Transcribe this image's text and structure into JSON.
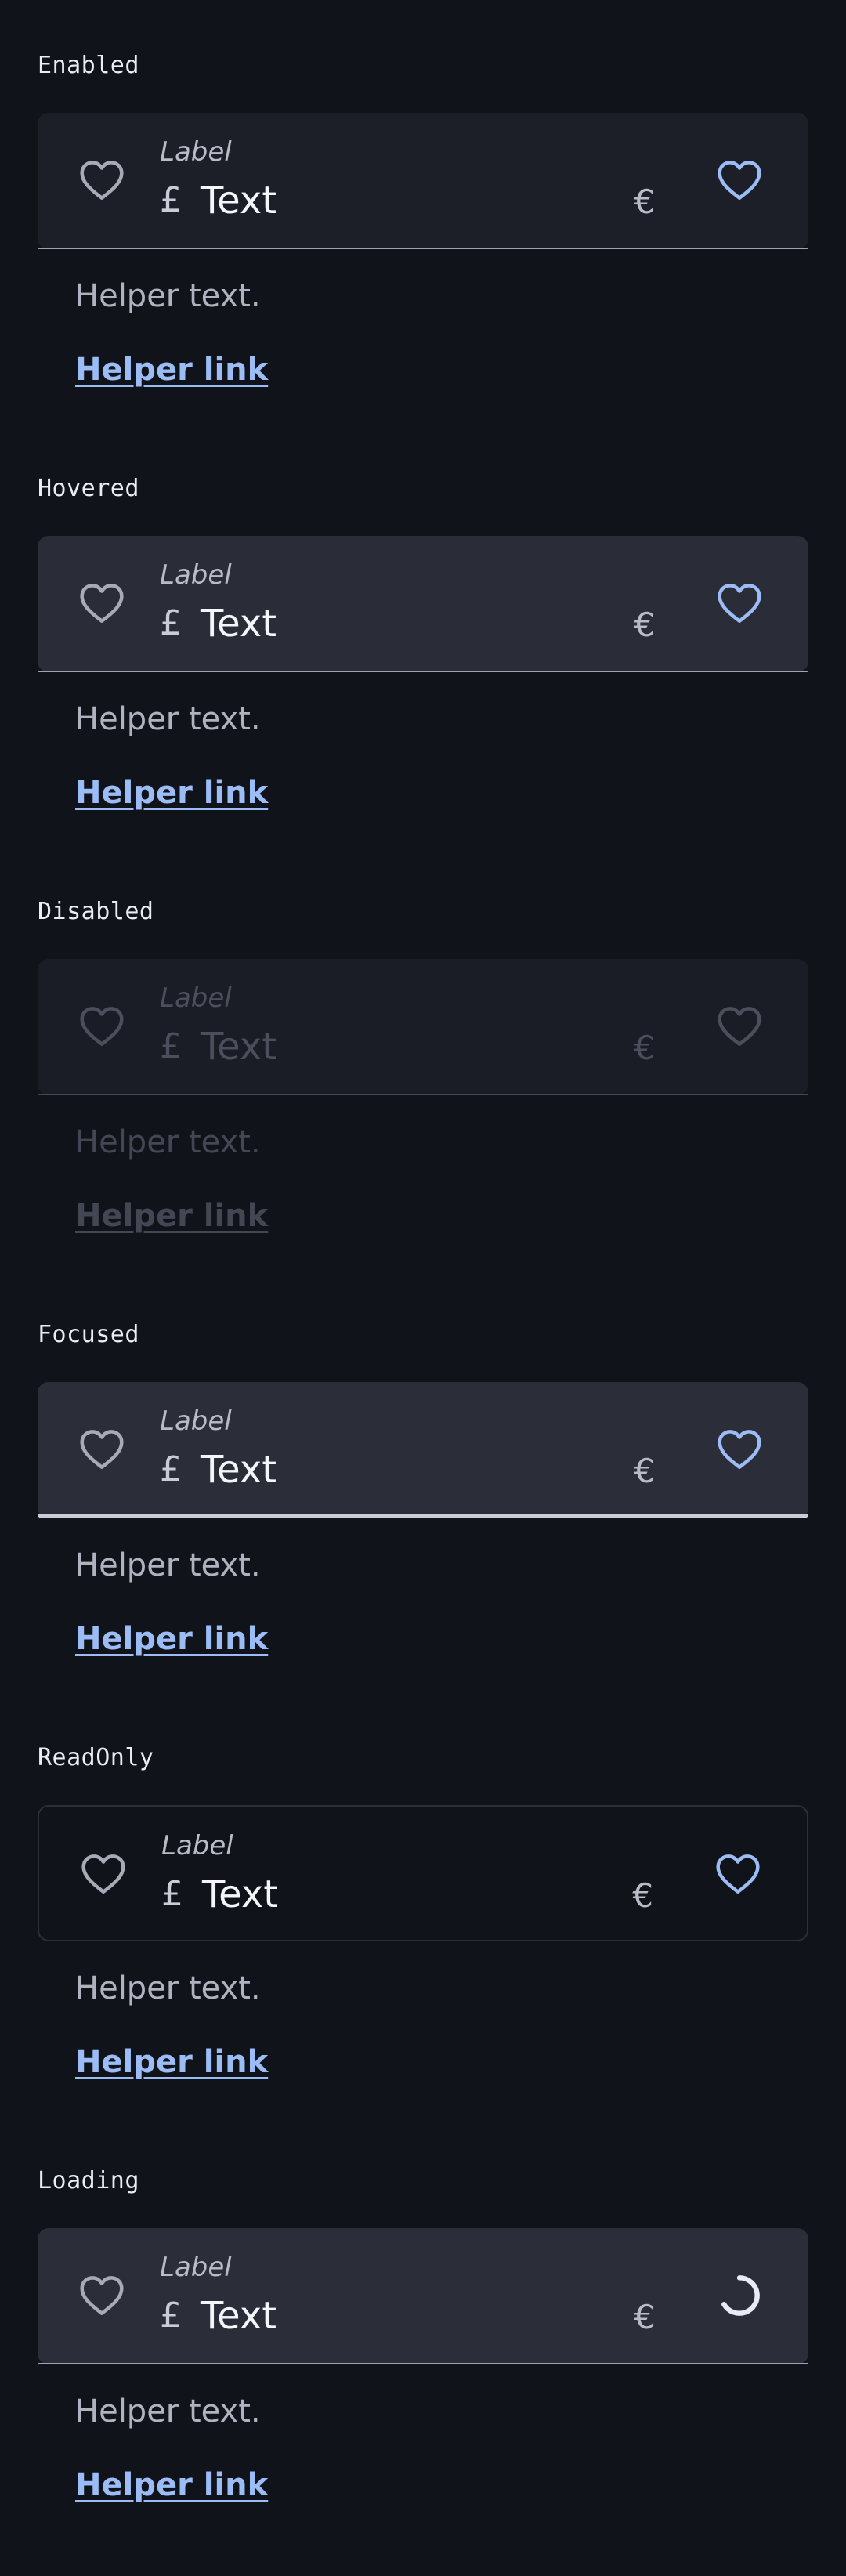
{
  "states": [
    {
      "title": "Enabled",
      "label": "Label",
      "prefix": "£",
      "value": "Text",
      "suffix": "€",
      "helper_text": "Helper text.",
      "helper_link": "Helper link",
      "trailing_icon": "heart-icon"
    },
    {
      "title": "Hovered",
      "label": "Label",
      "prefix": "£",
      "value": "Text",
      "suffix": "€",
      "helper_text": "Helper text.",
      "helper_link": "Helper link",
      "trailing_icon": "heart-icon"
    },
    {
      "title": "Disabled",
      "label": "Label",
      "prefix": "£",
      "value": "Text",
      "suffix": "€",
      "helper_text": "Helper text.",
      "helper_link": "Helper link",
      "trailing_icon": "heart-icon"
    },
    {
      "title": "Focused",
      "label": "Label",
      "prefix": "£",
      "value": "Text",
      "suffix": "€",
      "helper_text": "Helper text.",
      "helper_link": "Helper link",
      "trailing_icon": "heart-icon"
    },
    {
      "title": "ReadOnly",
      "label": "Label",
      "prefix": "£",
      "value": "Text",
      "suffix": "€",
      "helper_text": "Helper text.",
      "helper_link": "Helper link",
      "trailing_icon": "heart-icon"
    },
    {
      "title": "Loading",
      "label": "Label",
      "prefix": "£",
      "value": "Text",
      "suffix": "€",
      "helper_text": "Helper text.",
      "helper_link": "Helper link",
      "trailing_icon": "loading-spinner-icon"
    }
  ],
  "icons": {
    "leading": "heart-outline-icon",
    "trailing": "heart-outline-icon",
    "loading": "loading-spinner-icon"
  },
  "colors": {
    "background": "#10131a",
    "accent": "#9bbcf5",
    "icon_neutral": "#a7abb6",
    "disabled": "#434753"
  }
}
